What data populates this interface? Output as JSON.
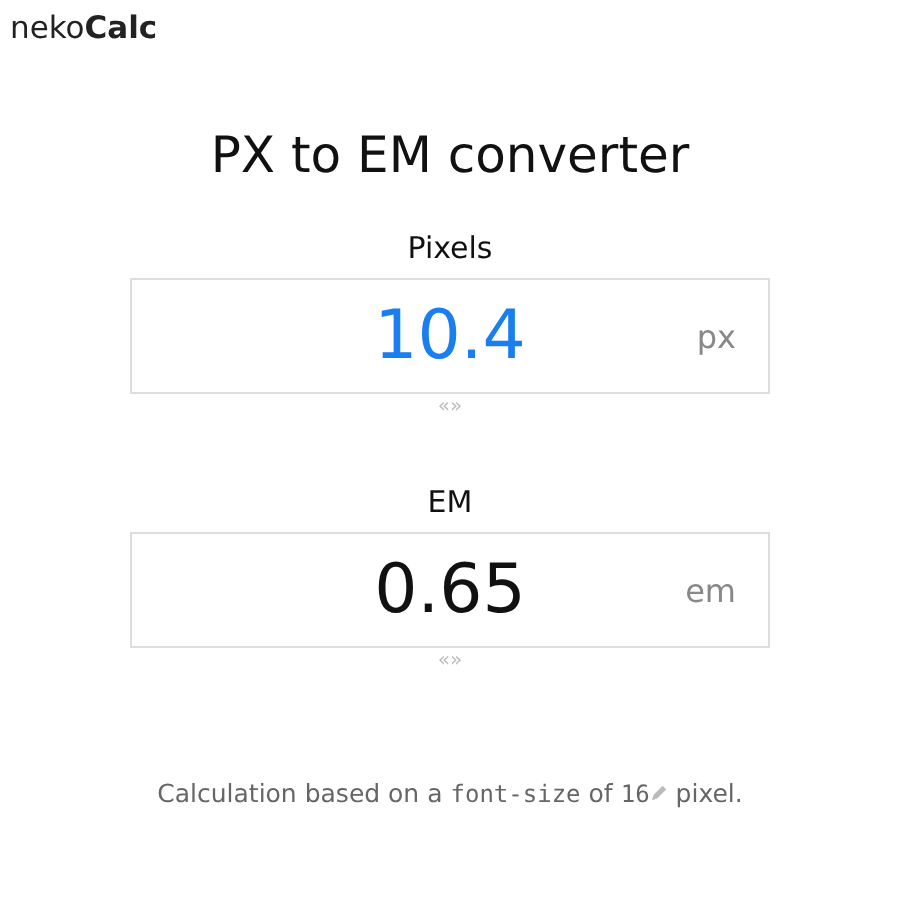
{
  "logo": {
    "prefix": "neko",
    "name": "Calc"
  },
  "title": "PX to EM converter",
  "fields": [
    {
      "label": "Pixels",
      "value": "10.4",
      "unit": "px",
      "active": true,
      "swap": "«»"
    },
    {
      "label": "EM",
      "value": "0.65",
      "unit": "em",
      "active": false,
      "swap": "«»"
    }
  ],
  "note": {
    "before": "Calculation based on a",
    "code": "font-size",
    "middle": "of",
    "value": "16",
    "after": "pixel."
  }
}
